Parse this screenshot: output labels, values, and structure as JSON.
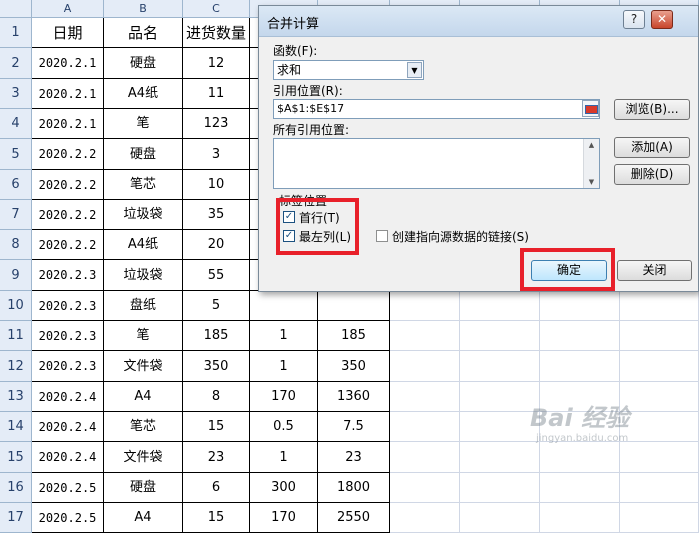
{
  "sheet": {
    "columns": [
      "A",
      "B",
      "C"
    ],
    "rows": [
      {
        "n": "1",
        "cells": [
          "日期",
          "品名",
          "进货数量",
          "",
          ""
        ]
      },
      {
        "n": "2",
        "cells": [
          "2020.2.1",
          "硬盘",
          "12",
          "",
          ""
        ]
      },
      {
        "n": "3",
        "cells": [
          "2020.2.1",
          "A4纸",
          "11",
          "",
          ""
        ]
      },
      {
        "n": "4",
        "cells": [
          "2020.2.1",
          "笔",
          "123",
          "",
          ""
        ]
      },
      {
        "n": "5",
        "cells": [
          "2020.2.2",
          "硬盘",
          "3",
          "",
          ""
        ]
      },
      {
        "n": "6",
        "cells": [
          "2020.2.2",
          "笔芯",
          "10",
          "",
          ""
        ]
      },
      {
        "n": "7",
        "cells": [
          "2020.2.2",
          "垃圾袋",
          "35",
          "",
          ""
        ]
      },
      {
        "n": "8",
        "cells": [
          "2020.2.2",
          "A4纸",
          "20",
          "",
          ""
        ]
      },
      {
        "n": "9",
        "cells": [
          "2020.2.3",
          "垃圾袋",
          "55",
          "",
          ""
        ]
      },
      {
        "n": "10",
        "cells": [
          "2020.2.3",
          "盘纸",
          "5",
          "",
          ""
        ]
      },
      {
        "n": "11",
        "cells": [
          "2020.2.3",
          "笔",
          "185",
          "1",
          "185"
        ]
      },
      {
        "n": "12",
        "cells": [
          "2020.2.3",
          "文件袋",
          "350",
          "1",
          "350"
        ]
      },
      {
        "n": "13",
        "cells": [
          "2020.2.4",
          "A4",
          "8",
          "170",
          "1360"
        ]
      },
      {
        "n": "14",
        "cells": [
          "2020.2.4",
          "笔芯",
          "15",
          "0.5",
          "7.5"
        ]
      },
      {
        "n": "15",
        "cells": [
          "2020.2.4",
          "文件袋",
          "23",
          "1",
          "23"
        ]
      },
      {
        "n": "16",
        "cells": [
          "2020.2.5",
          "硬盘",
          "6",
          "300",
          "1800"
        ]
      },
      {
        "n": "17",
        "cells": [
          "2020.2.5",
          "A4",
          "15",
          "170",
          "2550"
        ]
      }
    ]
  },
  "dialog": {
    "title": "合并计算",
    "help_label": "?",
    "close_label": "✕",
    "function_label": "函数(F):",
    "function_value": "求和",
    "reference_label": "引用位置(R):",
    "reference_value": "$A$1:$E$17",
    "browse_label": "浏览(B)...",
    "all_refs_label": "所有引用位置:",
    "add_label": "添加(A)",
    "delete_label": "删除(D)",
    "label_position_title": "标签位置",
    "top_row_label": "首行(T)",
    "left_column_label": "最左列(L)",
    "create_links_label": "创建指向源数据的链接(S)",
    "ok_label": "确定",
    "close_button_label": "关闭",
    "top_row_checked": true,
    "left_column_checked": true,
    "create_links_checked": false
  },
  "watermark": {
    "main": "Bai 经验",
    "sub": "jingyan.baidu.com"
  },
  "colors": {
    "highlight": "#e8202a",
    "header_bg": "#e4ecf7",
    "dialog_bg": "#f0f0f0"
  }
}
